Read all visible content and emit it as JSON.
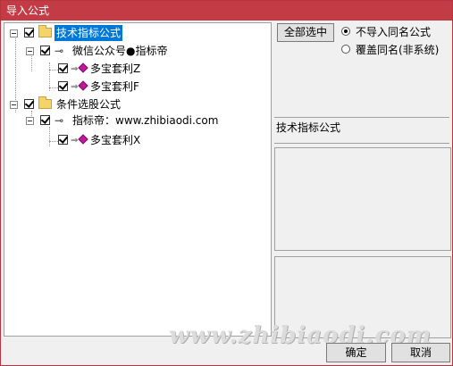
{
  "window": {
    "title": "导入公式"
  },
  "tree": {
    "root1": {
      "label": "技术指标公式"
    },
    "child1": {
      "label": "微信公众号●指标帝"
    },
    "leaf1": {
      "label": "多宝套利Z"
    },
    "leaf2": {
      "label": "多宝套利F"
    },
    "root2": {
      "label": "条件选股公式"
    },
    "child2": {
      "label": "指标帝：www.zhibiaodi.com"
    },
    "leaf3": {
      "label": "多宝套利X"
    }
  },
  "right": {
    "select_all_label": "全部选中",
    "option_no_import": "不导入同名公式",
    "option_overwrite": "覆盖同名(非系统)",
    "type_label": "技术指标公式"
  },
  "footer": {
    "ok_label": "确定",
    "cancel_label": "取消",
    "watermark": "www.zhibiaodi.com"
  },
  "colors": {
    "titlebar": "#c23b45",
    "selection": "#0078d7",
    "formula_icon": "#c2189b"
  }
}
